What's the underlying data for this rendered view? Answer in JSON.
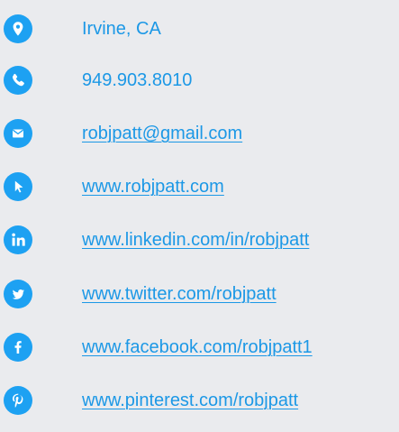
{
  "contact": {
    "accent_color": "#1da1f2",
    "items": [
      {
        "icon": "location-pin-icon",
        "text": "Irvine, CA"
      },
      {
        "icon": "phone-icon",
        "text": "949.903.8010"
      },
      {
        "icon": "email-icon",
        "text": "robjpatt@gmail.com"
      },
      {
        "icon": "cursor-pointer-icon",
        "text": "www.robjpatt.com"
      },
      {
        "icon": "linkedin-icon",
        "text": "www.linkedin.com/in/robjpatt"
      },
      {
        "icon": "twitter-icon",
        "text": "www.twitter.com/robjpatt"
      },
      {
        "icon": "facebook-icon",
        "text": "www.facebook.com/robjpatt1"
      },
      {
        "icon": "pinterest-icon",
        "text": "www.pinterest.com/robjpatt"
      }
    ]
  }
}
